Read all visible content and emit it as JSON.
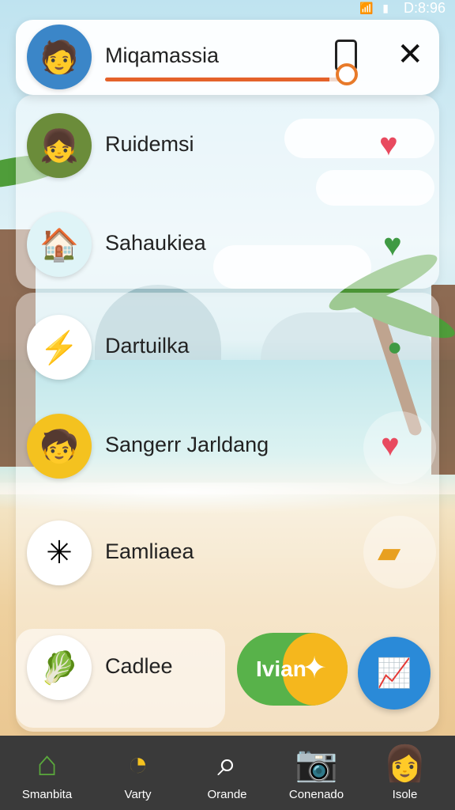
{
  "status_bar": {
    "time": "D:8:96",
    "icons": "wifi signal signal battery"
  },
  "header": {
    "title": "Miqamassia",
    "progress": 0.93
  },
  "list": [
    {
      "label": "Ruidemsi",
      "icon": "heart-icon",
      "heart_color": "#e84a5f"
    },
    {
      "label": "Sahaukiea",
      "icon": "heart-icon",
      "heart_color": "#3f9a43"
    },
    {
      "label": "Dartuilka",
      "icon": "heart-icon",
      "heart_color": "#3f9a43"
    },
    {
      "label": "Sangerr Jarldang",
      "icon": "heart-icon",
      "heart_color": "#e84a5f"
    },
    {
      "label": "Eamliaea",
      "icon": "flag-icon"
    },
    {
      "label": "Cadlee",
      "icon": "leaf-icon"
    }
  ],
  "action_pill": {
    "label": "Ivian"
  },
  "nav": [
    {
      "label": "Smanbita",
      "icon": "home-icon"
    },
    {
      "label": "Varty",
      "icon": "spin-icon"
    },
    {
      "label": "Orande",
      "icon": "search-icon"
    },
    {
      "label": "Conenado",
      "icon": "camera-icon"
    },
    {
      "label": "Isole",
      "icon": "avatar"
    }
  ]
}
